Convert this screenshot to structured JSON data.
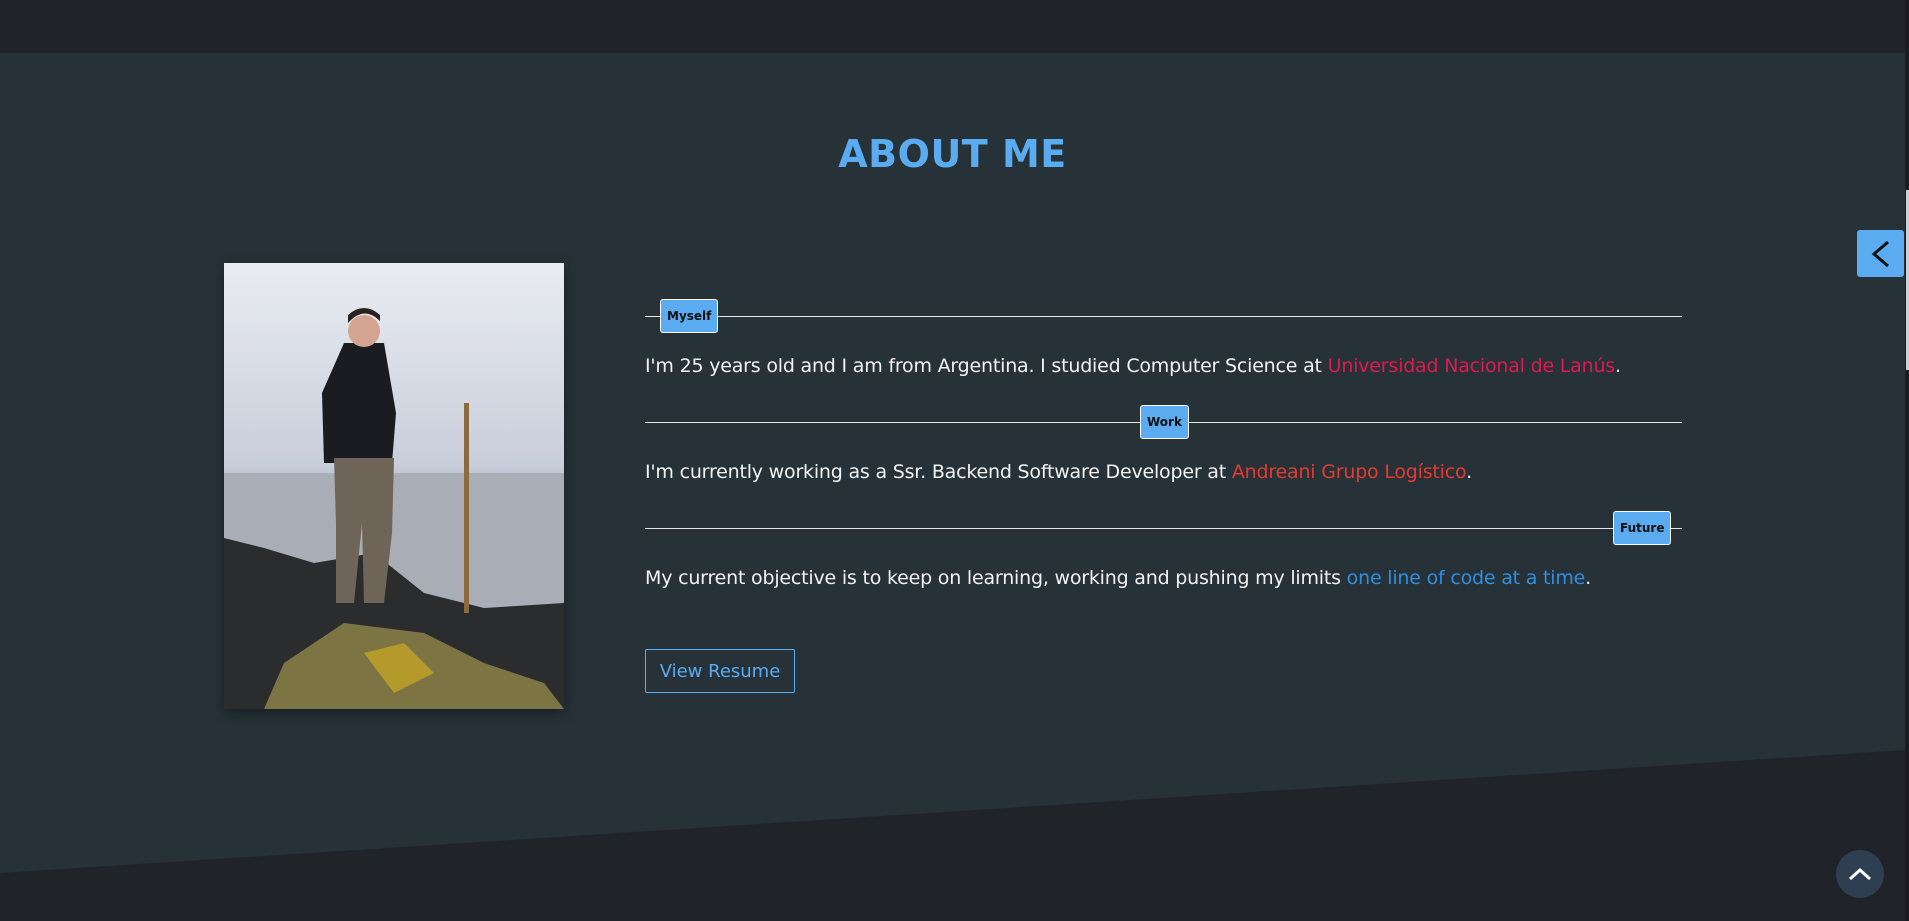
{
  "title": "ABOUT ME",
  "sections": [
    {
      "tag": "Myself",
      "text": "I'm 25 years old and I am from Argentina. I studied Computer Science at ",
      "link": "Universidad Nacional de Lanús",
      "link_color": "#e0194f",
      "end": "."
    },
    {
      "tag": "Work",
      "text": "I'm currently working as a Ssr. Backend Software Developer at ",
      "link": "Andreani Grupo Logístico",
      "link_color": "#e8392f",
      "end": "."
    },
    {
      "tag": "Future",
      "text": "My current objective is to keep on learning, working and pushing my limits ",
      "link": "one line of code at a time",
      "link_color": "#2f8ee0",
      "end": "."
    }
  ],
  "resume_button": "View Resume",
  "icons": {
    "side": "chevron-left-icon",
    "scroll": "chevron-up-icon"
  },
  "colors": {
    "accent": "#5aabf0",
    "background": "#263238",
    "dark": "#202327"
  }
}
